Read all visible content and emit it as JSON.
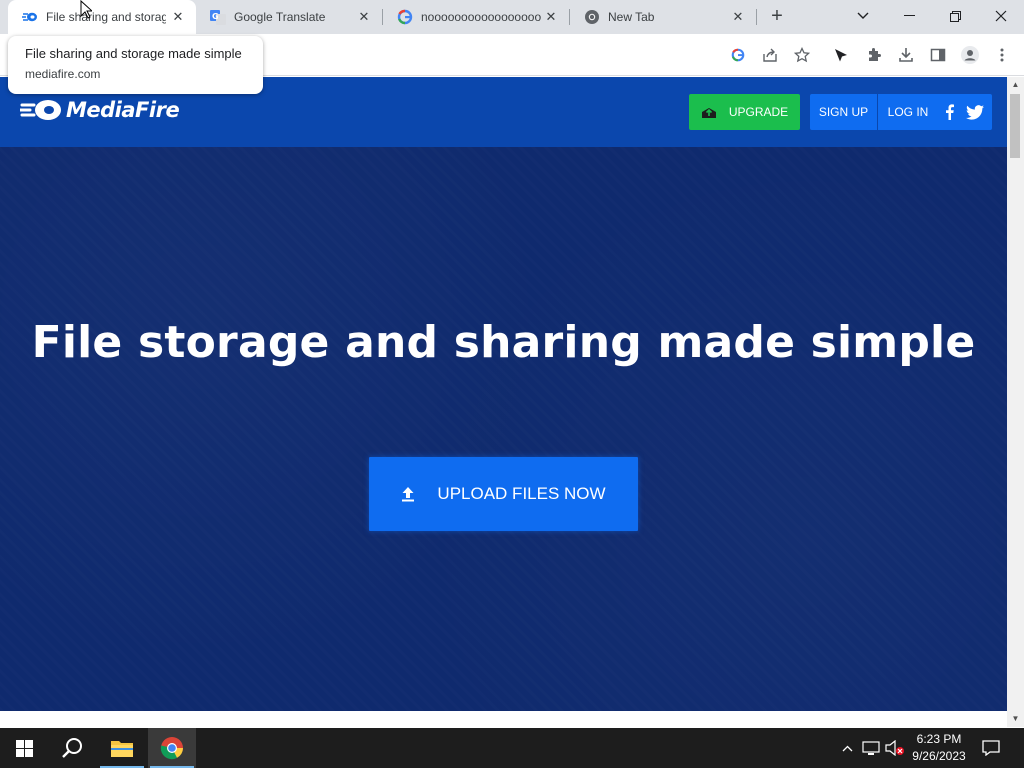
{
  "browser": {
    "tabs": [
      {
        "title": "File sharing and storage made simple",
        "favicon": "mediafire-icon",
        "active": true
      },
      {
        "title": "Google Translate",
        "favicon": "google-translate-icon",
        "active": false
      },
      {
        "title": "noooooooooooooooooooooooooo",
        "favicon": "google-icon",
        "active": false
      },
      {
        "title": "New Tab",
        "favicon": "chrome-icon",
        "active": false
      }
    ],
    "tooltip": {
      "title": "File sharing and storage made simple",
      "url": "mediafire.com"
    }
  },
  "page": {
    "logo_text": "MediaFire",
    "upgrade_label": "UPGRADE",
    "signup_label": "SIGN UP",
    "login_label": "LOG IN",
    "hero_title": "File storage and sharing made simple",
    "upload_label": "UPLOAD FILES NOW"
  },
  "taskbar": {
    "time": "6:23 PM",
    "date": "9/26/2023"
  },
  "colors": {
    "header_blue": "#0b47ad",
    "hero_navy": "#0f2a6e",
    "button_blue": "#0f6cf0",
    "upgrade_green": "#1bbe4d"
  }
}
